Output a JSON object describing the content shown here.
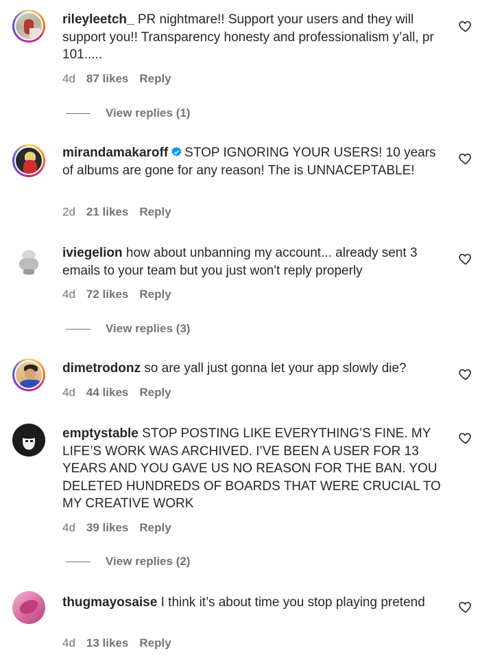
{
  "comments": [
    {
      "username": "rileyleetch_",
      "verified": false,
      "text": "PR nightmare!! Support your users and they will support you!! Transparency honesty and professionalism y’all, pr 101.....",
      "time": "4d",
      "likes": "87 likes",
      "reply": "Reply",
      "view_replies": "View replies (1)"
    },
    {
      "username": "mirandamakaroff",
      "verified": true,
      "text": "STOP IGNORING YOUR USERS! 10 years of albums are gone for any reason! The is UNNACEPTABLE!",
      "time": "2d",
      "likes": "21 likes",
      "reply": "Reply"
    },
    {
      "username": "iviegelion",
      "verified": false,
      "text": "how about unbanning my account... already sent 3 emails to your team but you just won't reply properly",
      "time": "4d",
      "likes": "72 likes",
      "reply": "Reply",
      "view_replies": "View replies (3)"
    },
    {
      "username": "dimetrodonz",
      "verified": false,
      "text": "so are yall just gonna let your app slowly die?",
      "time": "4d",
      "likes": "44 likes",
      "reply": "Reply"
    },
    {
      "username": "emptystable",
      "verified": false,
      "text": "STOP POSTING LIKE EVERYTHING’S FINE. MY LIFE’S WORK WAS ARCHIVED. I’VE BEEN A USER FOR 13 YEARS AND YOU GAVE US NO REASON FOR THE BAN. YOU DELETED HUNDREDS OF BOARDS THAT WERE CRUCIAL TO MY CREATIVE WORK",
      "time": "4d",
      "likes": "39 likes",
      "reply": "Reply",
      "view_replies": "View replies (2)"
    },
    {
      "username": "thugmayosaise",
      "verified": false,
      "text": "I think it’s about time you stop playing pretend",
      "time": "4d",
      "likes": "13 likes",
      "reply": "Reply"
    }
  ],
  "colors": {
    "text": "#262626",
    "secondary": "#737373",
    "verified": "#0095f6"
  }
}
